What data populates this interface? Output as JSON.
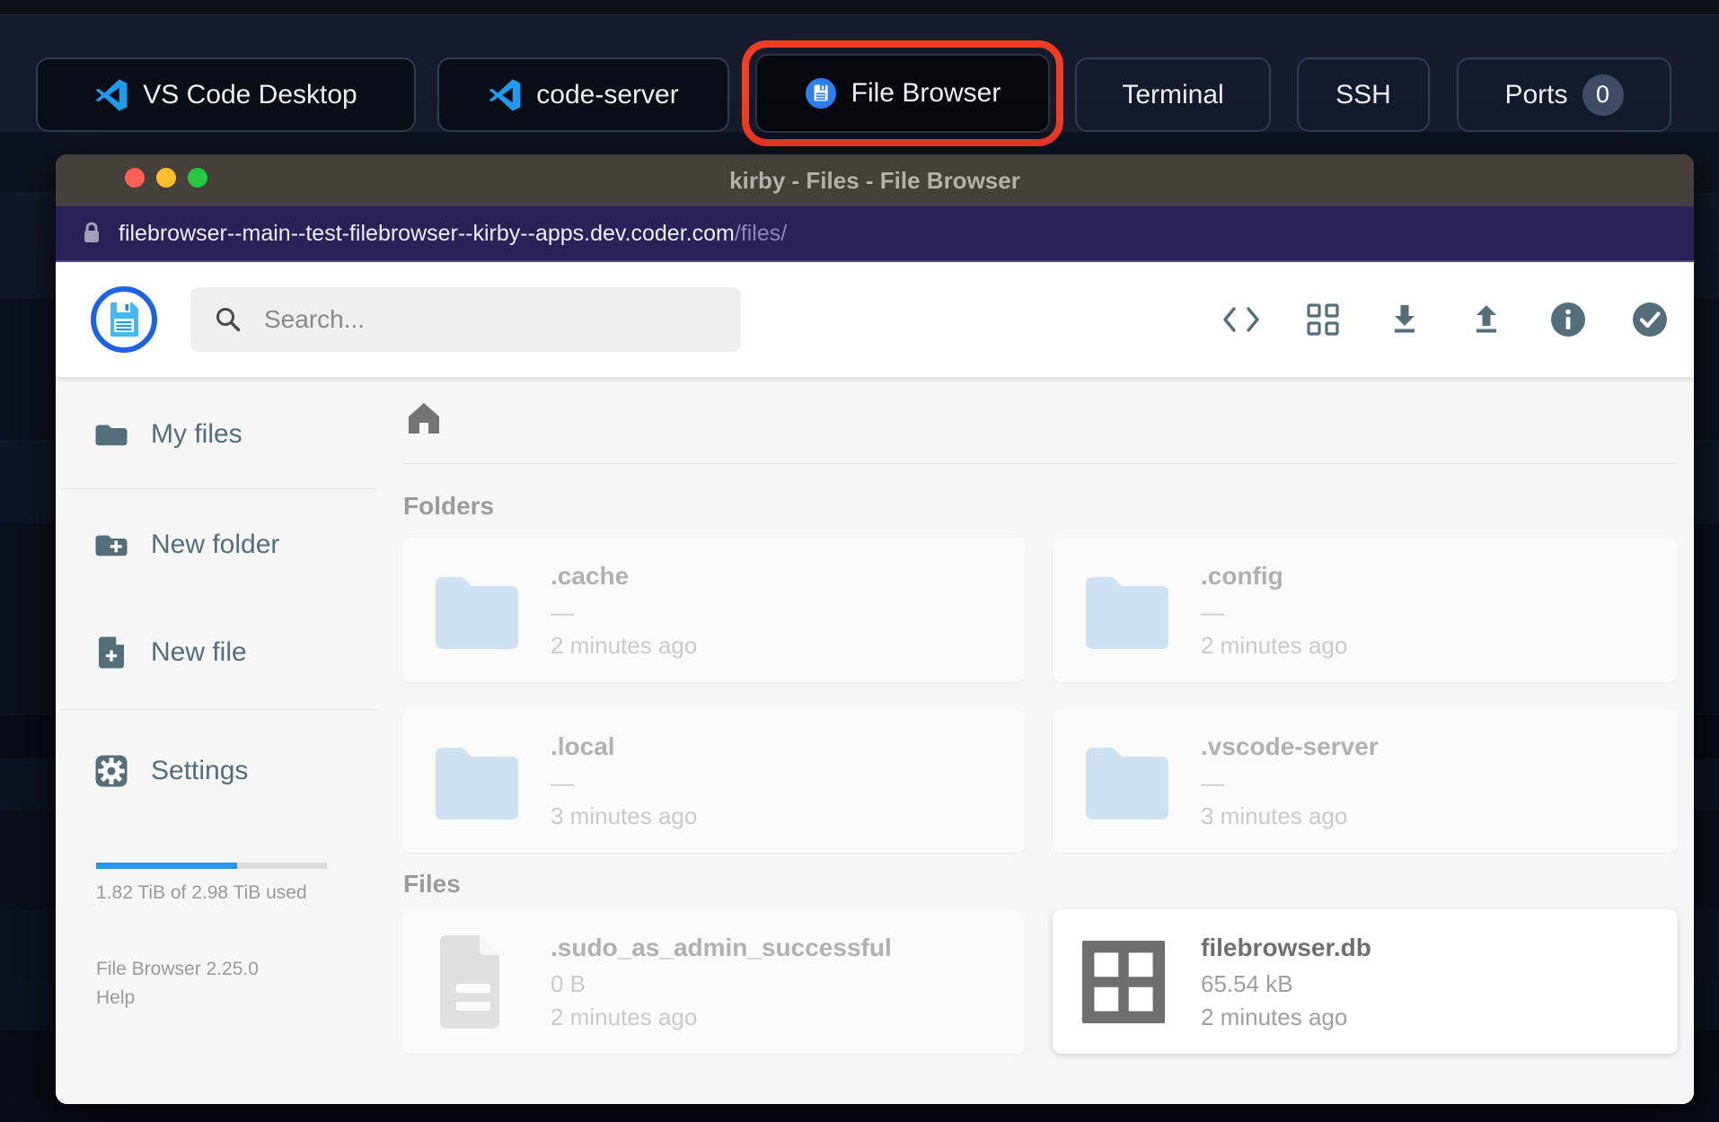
{
  "topbar": {
    "buttons": [
      {
        "label": "VS Code Desktop"
      },
      {
        "label": "code-server"
      },
      {
        "label": "File Browser",
        "highlighted": true
      },
      {
        "label": "Terminal"
      },
      {
        "label": "SSH"
      },
      {
        "label": "Ports",
        "badge": "0"
      }
    ]
  },
  "window": {
    "title": "kirby - Files - File Browser",
    "url_host": "filebrowser--main--test-filebrowser--kirby--apps.dev.coder.com",
    "url_path": "/files/"
  },
  "header": {
    "search_placeholder": "Search..."
  },
  "sidebar": {
    "items": [
      {
        "label": "My files"
      },
      {
        "label": "New folder"
      },
      {
        "label": "New file"
      },
      {
        "label": "Settings"
      }
    ],
    "storage": {
      "text": "1.82 TiB of 2.98 TiB used",
      "percent": 61
    },
    "version": "File Browser 2.25.0",
    "help": "Help"
  },
  "content": {
    "sections": [
      {
        "title": "Folders",
        "items": [
          {
            "name": ".cache",
            "size": "—",
            "modified": "2 minutes ago"
          },
          {
            "name": ".config",
            "size": "—",
            "modified": "2 minutes ago"
          },
          {
            "name": ".local",
            "size": "—",
            "modified": "3 minutes ago"
          },
          {
            "name": ".vscode-server",
            "size": "—",
            "modified": "3 minutes ago"
          }
        ]
      },
      {
        "title": "Files",
        "items": [
          {
            "name": ".sudo_as_admin_successful",
            "size": "0 B",
            "modified": "2 minutes ago"
          },
          {
            "name": "filebrowser.db",
            "size": "65.54 kB",
            "modified": "2 minutes ago"
          }
        ]
      }
    ]
  },
  "colors": {
    "accent_blue": "#2196f3",
    "highlight_ring": "#f43b23",
    "folder_icon": "#a8cdf2",
    "toolbar_icon": "#546e7a",
    "titlebar": "#46403b",
    "urlbar": "#2a2158"
  },
  "icons": {
    "toolbar": [
      "code-icon",
      "grid-view-icon",
      "download-icon",
      "upload-icon",
      "info-icon",
      "select-multiple-icon"
    ]
  }
}
